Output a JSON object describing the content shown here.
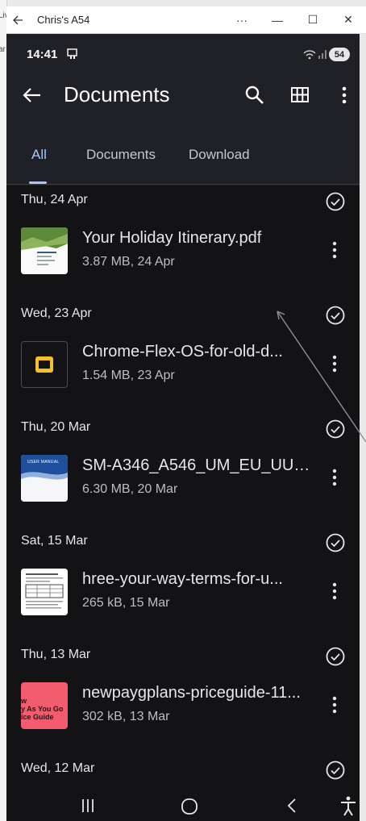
{
  "window": {
    "title": "Chris's A54",
    "minimize": "—",
    "more": "···",
    "maximize": "☐",
    "close": "✕",
    "host_fragments": [
      "Liv",
      "ar"
    ]
  },
  "status": {
    "time": "14:41",
    "battery": "54"
  },
  "appbar": {
    "title": "Documents"
  },
  "tabs": [
    {
      "label": "All",
      "selected": true
    },
    {
      "label": "Documents",
      "selected": false
    },
    {
      "label": "Download",
      "selected": false
    }
  ],
  "groups": [
    {
      "date": "Thu, 24 Apr",
      "file": {
        "name": "Your Holiday Itinerary.pdf",
        "meta": "3.87 MB, 24 Apr",
        "thumb": "holiday-itinerary-thumbnail"
      }
    },
    {
      "date": "Wed, 23 Apr",
      "file": {
        "name": "Chrome-Flex-OS-for-old-d...",
        "meta": "1.54 MB, 23 Apr",
        "thumb": "slides-file-icon"
      }
    },
    {
      "date": "Thu, 20 Mar",
      "file": {
        "name": "SM-A346_A546_UM_EU_UU_...",
        "meta": "6.30 MB, 20 Mar",
        "thumb": "user-manual-thumbnail",
        "thumb_text": "USER MANUAL"
      }
    },
    {
      "date": "Sat, 15 Mar",
      "file": {
        "name": "hree-your-way-terms-for-u...",
        "meta": "265 kB, 15 Mar",
        "thumb": "terms-document-thumbnail"
      }
    },
    {
      "date": "Thu, 13 Mar",
      "file": {
        "name": "newpaygplans-priceguide-11...",
        "meta": "302 kB, 13 Mar",
        "thumb": "price-guide-thumbnail",
        "thumb_text": [
          "w",
          "y As You Go",
          "ice Guide"
        ]
      }
    },
    {
      "date": "Wed, 12 Mar"
    }
  ],
  "colors": {
    "accent": "#a9c7ff",
    "appbar_bg": "#202126",
    "list_bg": "#131316",
    "slides_icon": "#f6c028",
    "price_guide": "#f25c6e"
  }
}
